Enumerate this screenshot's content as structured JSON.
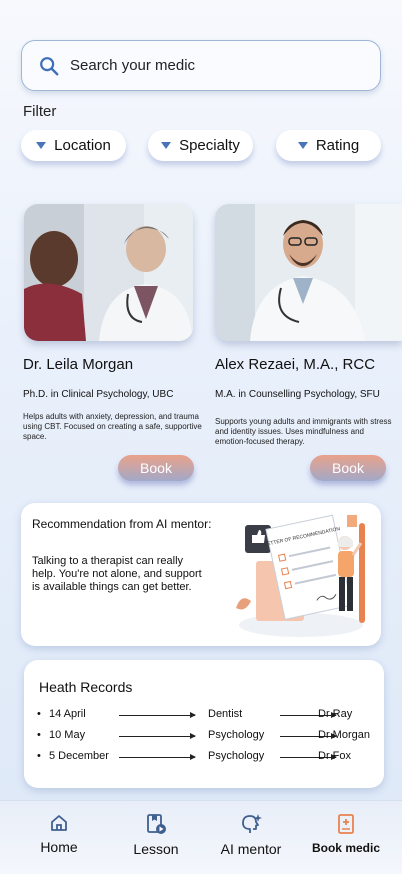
{
  "search": {
    "placeholder": "Search your medic"
  },
  "filter": {
    "label": "Filter",
    "chips": [
      {
        "label": "Location"
      },
      {
        "label": "Specialty"
      },
      {
        "label": "Rating"
      }
    ]
  },
  "doctors": [
    {
      "name": "Dr. Leila Morgan",
      "degree": "Ph.D. in Clinical Psychology, UBC",
      "description": "Helps adults with anxiety, depression, and trauma using CBT. Focused on creating a safe, supportive space.",
      "book_label": "Book"
    },
    {
      "name": "Alex Rezaei, M.A., RCC",
      "degree": "M.A. in Counselling Psychology, SFU",
      "description": "Supports young adults and immigrants with stress and identity issues. Uses mindfulness and emotion-focused therapy.",
      "book_label": "Book"
    }
  ],
  "recommendation": {
    "title": "Recommendation from AI mentor:",
    "body": "Talking to a therapist can really help. You're not alone, and support is available things can get better.",
    "illustration_text": "LETTER OF RECOMMENDATION"
  },
  "health_records": {
    "title": "Heath Records",
    "rows": [
      {
        "date": "14 April",
        "type": "Dentist",
        "doctor": "Dr Ray"
      },
      {
        "date": "10 May",
        "type": "Psychology",
        "doctor": "Dr Morgan"
      },
      {
        "date": "5 December",
        "type": "Psychology",
        "doctor": "Dr Fox"
      }
    ]
  },
  "nav": {
    "items": [
      {
        "label": "Home",
        "icon": "home-icon"
      },
      {
        "label": "Lesson",
        "icon": "lesson-icon"
      },
      {
        "label": "AI mentor",
        "icon": "ai-mentor-icon"
      },
      {
        "label": "Book medic",
        "icon": "book-medic-icon",
        "active": true
      }
    ],
    "active_color": "#e8834f"
  }
}
